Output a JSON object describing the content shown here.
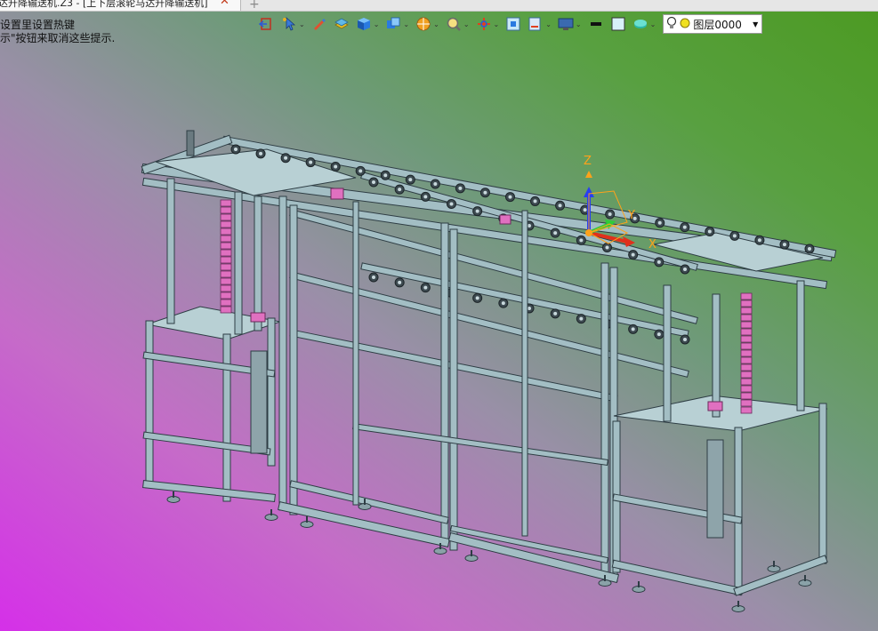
{
  "tab": {
    "title": "达升降输送机.Z3 - [上下层滚轮马达升降输送机]",
    "close_glyph": "✕",
    "new_tab_glyph": "+"
  },
  "hints": {
    "line1": "设置里设置热键",
    "line2": "示\"按钮来取消这些提示."
  },
  "toolbar": {
    "tools": [
      {
        "name": "exit-icon",
        "dropdown": false
      },
      {
        "name": "pointer-icon",
        "dropdown": true
      },
      {
        "name": "pen-icon",
        "dropdown": false
      },
      {
        "name": "layers-icon",
        "dropdown": false
      },
      {
        "name": "cube-icon",
        "dropdown": true
      },
      {
        "name": "view-cube-icon",
        "dropdown": true
      },
      {
        "name": "render-icon",
        "dropdown": true
      },
      {
        "name": "zoom-icon",
        "dropdown": true
      },
      {
        "name": "orient-icon",
        "dropdown": true
      },
      {
        "name": "frame-icon",
        "dropdown": false
      },
      {
        "name": "section-icon",
        "dropdown": true
      },
      {
        "name": "display-icon",
        "dropdown": true
      },
      {
        "name": "line-style-icon",
        "dropdown": false
      },
      {
        "name": "color-swatch-icon",
        "dropdown": false
      },
      {
        "name": "material-icon",
        "dropdown": true
      }
    ],
    "layer": {
      "value": "图层0000",
      "dropdown_glyph": "▼"
    }
  },
  "triad": {
    "z_label": "Z",
    "x_label": "X",
    "y_label": "Y"
  },
  "colors": {
    "frame": "#a3bec4",
    "frame_edge": "#2e3d44",
    "accent_pink": "#e070c0",
    "axis_x": "#e0301c",
    "axis_y": "#2ecc3a",
    "axis_z": "#2a3ef0",
    "triad_label": "#ffa21a"
  }
}
